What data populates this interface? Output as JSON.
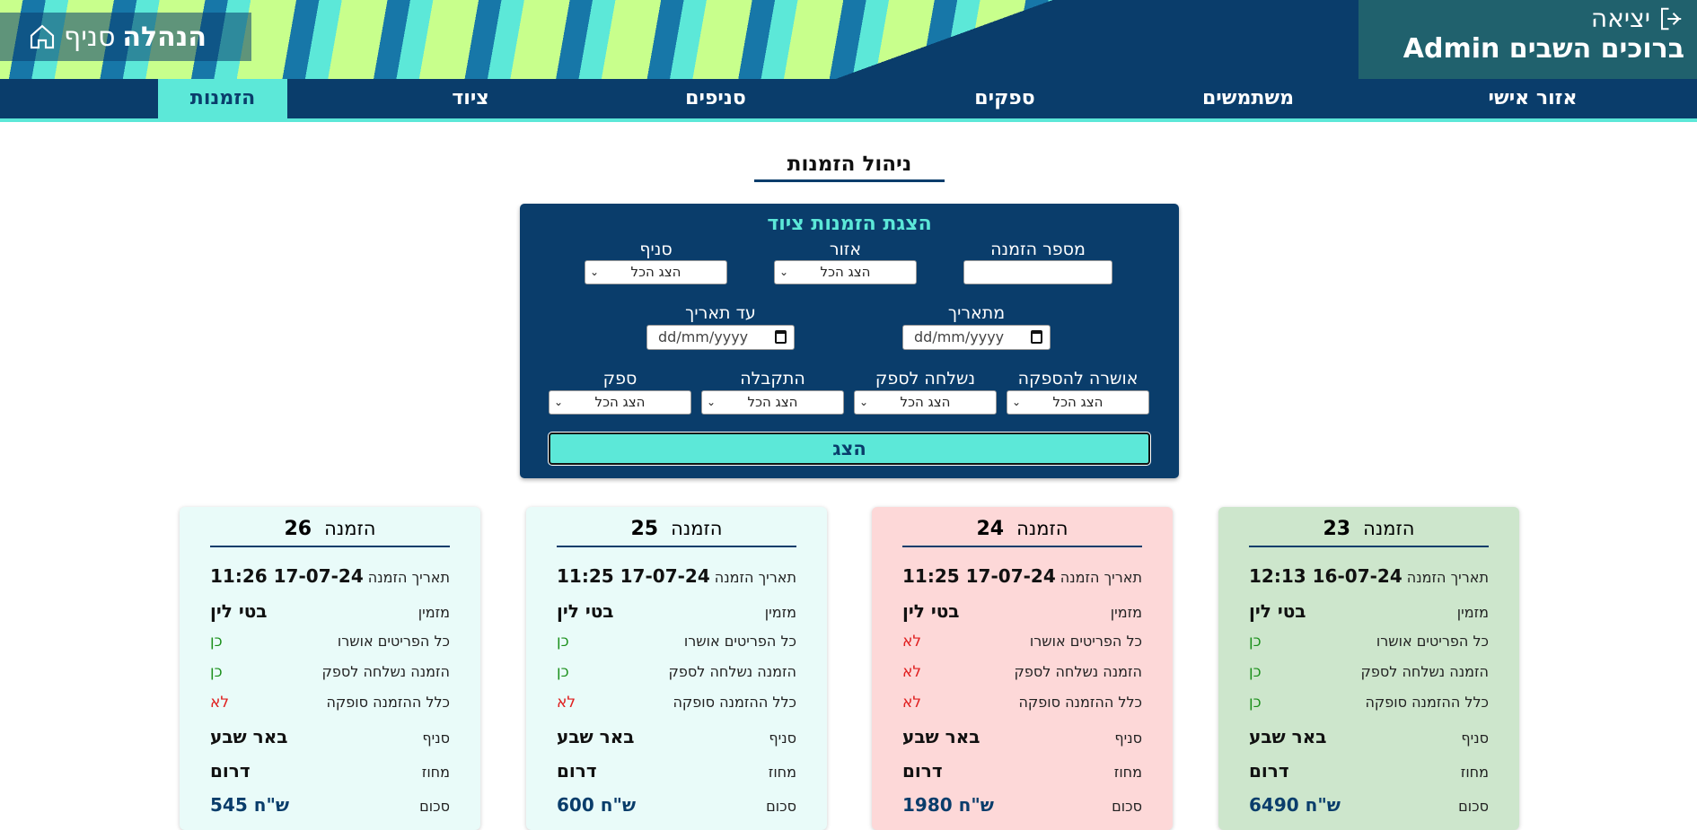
{
  "header": {
    "home_prefix": "סניף",
    "home_title": "הנהלה",
    "logout": "יציאה",
    "greeting": "ברוכים השבים Admin"
  },
  "nav": [
    {
      "label": "אזור אישי"
    },
    {
      "label": "משתמשים"
    },
    {
      "label": "ספקים"
    },
    {
      "label": "סניפים"
    },
    {
      "label": "ציוד"
    },
    {
      "label": "הזמנות",
      "active": true
    }
  ],
  "page_title": "ניהול הזמנות",
  "filter": {
    "title": "הצגת הזמנות ציוד",
    "order_number_label": "מספר הזמנה",
    "order_number_value": "",
    "region_label": "אזור",
    "region_value": "הצג הכל",
    "branch_label": "סניף",
    "branch_value": "הצג הכל",
    "from_date_label": "מתאריך",
    "from_date_placeholder": "dd/mm/yyyy",
    "to_date_label": "עד תאריך",
    "to_date_placeholder": "dd/mm/yyyy",
    "approved_label": "אושרה להספקה",
    "approved_value": "הצג הכל",
    "sent_label": "נשלחה לספק",
    "sent_value": "הצג הכל",
    "received_label": "התקבלה",
    "received_value": "הצג הכל",
    "supplier_label": "ספק",
    "supplier_value": "הצג הכל",
    "submit": "הצג"
  },
  "card_labels": {
    "order": "הזמנה",
    "date": "תאריך הזמנה",
    "orderer": "מזמין",
    "all_approved": "כל הפריטים אושרו",
    "sent": "הזמנה נשלחה לספק",
    "supplied": "כלל ההזמנה סופקה",
    "branch": "סניף",
    "district": "מחוז",
    "total": "סכום"
  },
  "orders": [
    {
      "number": "23",
      "date": "16-07-24 12:13",
      "orderer": "בטי לין",
      "all_approved": "כן",
      "sent": "כן",
      "supplied": "כן",
      "branch": "באר שבע",
      "district": "דרום",
      "total": "ש\"ח 6490",
      "bg": "#cde6cc"
    },
    {
      "number": "24",
      "date": "17-07-24 11:25",
      "orderer": "בטי לין",
      "all_approved": "לא",
      "sent": "לא",
      "supplied": "לא",
      "branch": "באר שבע",
      "district": "דרום",
      "total": "ש\"ח 1980",
      "bg": "#fdd8d8"
    },
    {
      "number": "25",
      "date": "17-07-24 11:25",
      "orderer": "בטי לין",
      "all_approved": "כן",
      "sent": "כן",
      "supplied": "לא",
      "branch": "באר שבע",
      "district": "דרום",
      "total": "ש\"ח 600",
      "bg": "#e9fbf9"
    },
    {
      "number": "26",
      "date": "17-07-24 11:26",
      "orderer": "בטי לין",
      "all_approved": "כן",
      "sent": "כן",
      "supplied": "לא",
      "branch": "באר שבע",
      "district": "דרום",
      "total": "ש\"ח 545",
      "bg": "#e9fbf9"
    }
  ]
}
